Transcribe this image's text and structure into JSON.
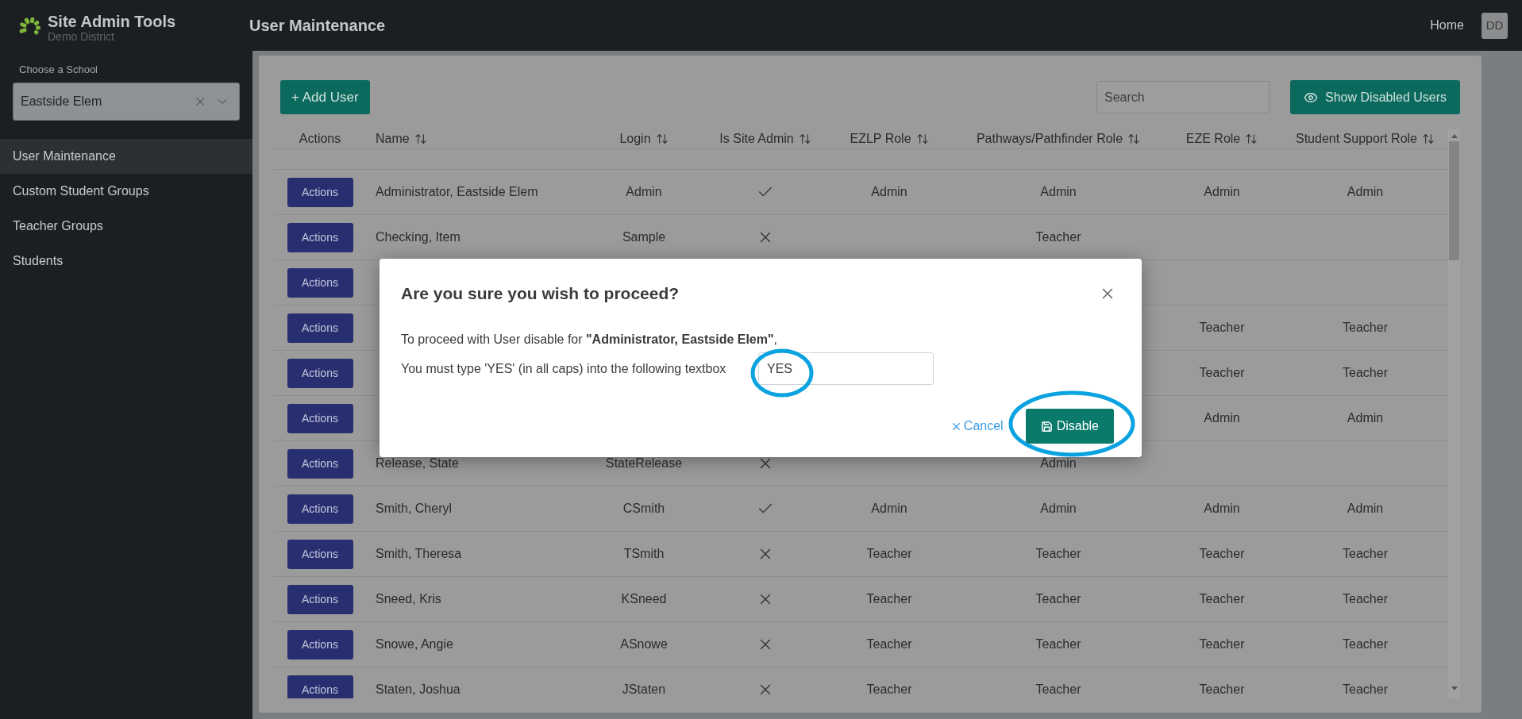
{
  "brand": {
    "title": "Site Admin Tools",
    "subtitle": "Demo District"
  },
  "page_title": "User Maintenance",
  "top_links": [
    {
      "label": "Home"
    }
  ],
  "avatar": "DD",
  "school_picker": {
    "label": "Choose a School",
    "value": "Eastside Elem"
  },
  "sidebar": {
    "items": [
      {
        "label": "User Maintenance",
        "selected": true
      },
      {
        "label": "Custom Student Groups",
        "selected": false
      },
      {
        "label": "Teacher Groups",
        "selected": false
      },
      {
        "label": "Students",
        "selected": false
      }
    ]
  },
  "toolbar": {
    "add_button": "+ Add User",
    "search": {
      "placeholder": "Search"
    },
    "show_disabled_button": "Show Disabled Users"
  },
  "table": {
    "columns": [
      {
        "label": "Actions",
        "sortable": false
      },
      {
        "label": "Name",
        "sortable": true
      },
      {
        "label": "Login",
        "sortable": true
      },
      {
        "label": "Is Site Admin",
        "sortable": true
      },
      {
        "label": "EZLP Role",
        "sortable": true
      },
      {
        "label": "Pathways/Pathfinder Role",
        "sortable": true
      },
      {
        "label": "EZE Role",
        "sortable": true
      },
      {
        "label": "Student Support Role",
        "sortable": true
      }
    ],
    "rows": [
      {
        "action": "Actions",
        "name": "Administrator, Eastside Elem",
        "login": "Admin",
        "site_admin": true,
        "ezlp": "Admin",
        "pathways": "Admin",
        "eze": "Admin",
        "student_support": "Admin"
      },
      {
        "action": "Actions",
        "name": "Checking, Item",
        "login": "Sample",
        "site_admin": false,
        "pathways": "Teacher"
      },
      {
        "action": "Actions"
      },
      {
        "action": "Actions",
        "eze": "Teacher",
        "student_support": "Teacher"
      },
      {
        "action": "Actions",
        "eze": "Teacher",
        "student_support": "Teacher"
      },
      {
        "action": "Actions",
        "eze": "Admin",
        "student_support": "Admin"
      },
      {
        "action": "Actions",
        "name": "Release, State",
        "login": "StateRelease",
        "site_admin": false,
        "pathways": "Admin"
      },
      {
        "action": "Actions",
        "name": "Smith, Cheryl",
        "login": "CSmith",
        "site_admin": true,
        "ezlp": "Admin",
        "pathways": "Admin",
        "eze": "Admin",
        "student_support": "Admin"
      },
      {
        "action": "Actions",
        "name": "Smith, Theresa",
        "login": "TSmith",
        "site_admin": false,
        "ezlp": "Teacher",
        "pathways": "Teacher",
        "eze": "Teacher",
        "student_support": "Teacher"
      },
      {
        "action": "Actions",
        "name": "Sneed, Kris",
        "login": "KSneed",
        "site_admin": false,
        "ezlp": "Teacher",
        "pathways": "Teacher",
        "eze": "Teacher",
        "student_support": "Teacher"
      },
      {
        "action": "Actions",
        "name": "Snowe, Angie",
        "login": "ASnowe",
        "site_admin": false,
        "ezlp": "Teacher",
        "pathways": "Teacher",
        "eze": "Teacher",
        "student_support": "Teacher"
      },
      {
        "action": "Actions",
        "name": "Staten, Joshua",
        "login": "JStaten",
        "site_admin": false,
        "ezlp": "Teacher",
        "pathways": "Teacher",
        "eze": "Teacher",
        "student_support": "Teacher"
      }
    ]
  },
  "dialog": {
    "title": "Are you sure you wish to proceed?",
    "message": "To proceed with User disable for **\"Administrator, Eastside Elem\"**,",
    "prompt": "You must type 'YES' (in all caps) into the following textbox",
    "input_value": "YES",
    "cancel": "Cancel",
    "confirm": "Disable"
  }
}
